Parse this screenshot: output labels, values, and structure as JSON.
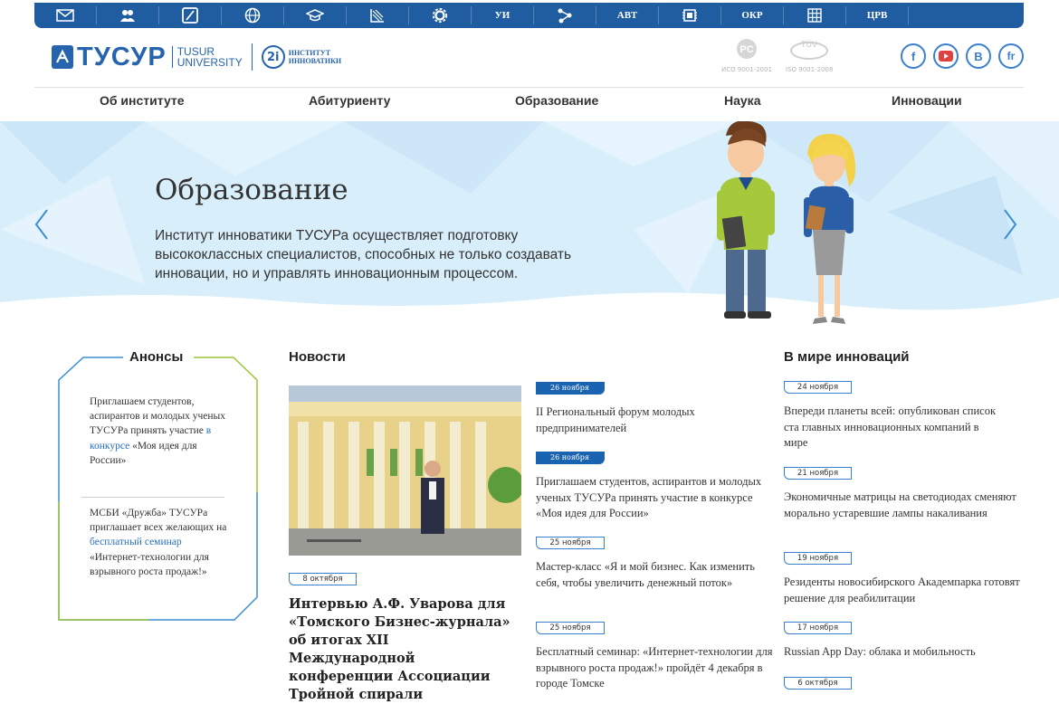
{
  "topbar": {
    "items": [
      {
        "icon": "mail-icon"
      },
      {
        "icon": "people-icon"
      },
      {
        "icon": "book-icon"
      },
      {
        "icon": "globe-icon"
      },
      {
        "icon": "graduation-cap-icon"
      },
      {
        "icon": "chart-icon"
      },
      {
        "icon": "gear-icon"
      },
      {
        "label": "УИ"
      },
      {
        "icon": "network-icon"
      },
      {
        "label": "АВТ"
      },
      {
        "icon": "chip-icon"
      },
      {
        "label": "ОКР"
      },
      {
        "icon": "grid-icon"
      },
      {
        "label": "ЦРВ"
      }
    ]
  },
  "header": {
    "logo_main": "ТУСУР",
    "logo_en_1": "TUSUR",
    "logo_en_2": "UNIVERSITY",
    "inst_badge": "2i",
    "inst_line1": "ИНСТИТУТ",
    "inst_line2": "ИННОВАТИКИ",
    "cert1": "ИСО 9001-2001",
    "cert2": "ISO 9001-2008",
    "social": [
      "f",
      "▶",
      "В",
      "fr"
    ]
  },
  "nav": [
    "Об институте",
    "Абитуриенту",
    "Образование",
    "Наука",
    "Инновации"
  ],
  "hero": {
    "title": "Образование",
    "description": "Институт инноватики ТУСУРа осуществляет подготовку высококлассных специалистов, способных не только создавать инновации, но и управлять инновационным процессом."
  },
  "anons": {
    "title": "Анонсы",
    "item1": {
      "before": "Приглашаем студентов, аспирантов и молодых ученых ТУСУРа принять участие ",
      "link": "в конкурсе",
      "after": " «Моя идея для России»"
    },
    "item2": {
      "before": "МСБИ «Дружба» ТУСУРа приглашает всех желающих на ",
      "link": "бесплатный семинар",
      "after": " «Интернет-технологии для взрывного роста продаж!»"
    }
  },
  "news": {
    "title": "Новости",
    "featured_date": "8 октября",
    "featured_title": "Интервью А.Ф. Уварова для «Томского Бизнес-журнала» об итогах XII Международной конференции Ассоциации Тройной спирали",
    "items": [
      {
        "date": "26 ноября",
        "text": "II Региональный форум молодых предпринимателей"
      },
      {
        "date": "26 ноября",
        "text": "Приглашаем студентов, аспирантов и молодых ученых ТУСУРа принять участие в конкурсе «Моя идея для России»"
      },
      {
        "date": "25 ноября",
        "text": "Мастер-класс «Я и мой бизнес. Как изменить себя, чтобы увеличить денежный поток»"
      },
      {
        "date": "25 ноября",
        "text": "Бесплатный семинар: «Интернет-технологии для взрывного роста продаж!» пройдёт 4 декабря в городе Томске"
      }
    ]
  },
  "world": {
    "title": "В мире инноваций",
    "items": [
      {
        "date": "24 ноября",
        "text": "Впереди планеты всей: опубликован список ста главных инновационных компаний в мире"
      },
      {
        "date": "21 ноября",
        "text": "Экономичные матрицы на светодиодах сменяют морально устаревшие лампы накаливания"
      },
      {
        "date": "19 ноября",
        "text": "Резиденты новосибирского Академпарка готовят решение для реабилитации"
      },
      {
        "date": "17 ноября",
        "text": "Russian App Day: облака и мобильность"
      },
      {
        "date": "6 октября",
        "text": ""
      }
    ]
  },
  "colors": {
    "brand": "#1f5da0",
    "accent": "#2a6fc0",
    "hero_bg": "#d8eefb"
  }
}
